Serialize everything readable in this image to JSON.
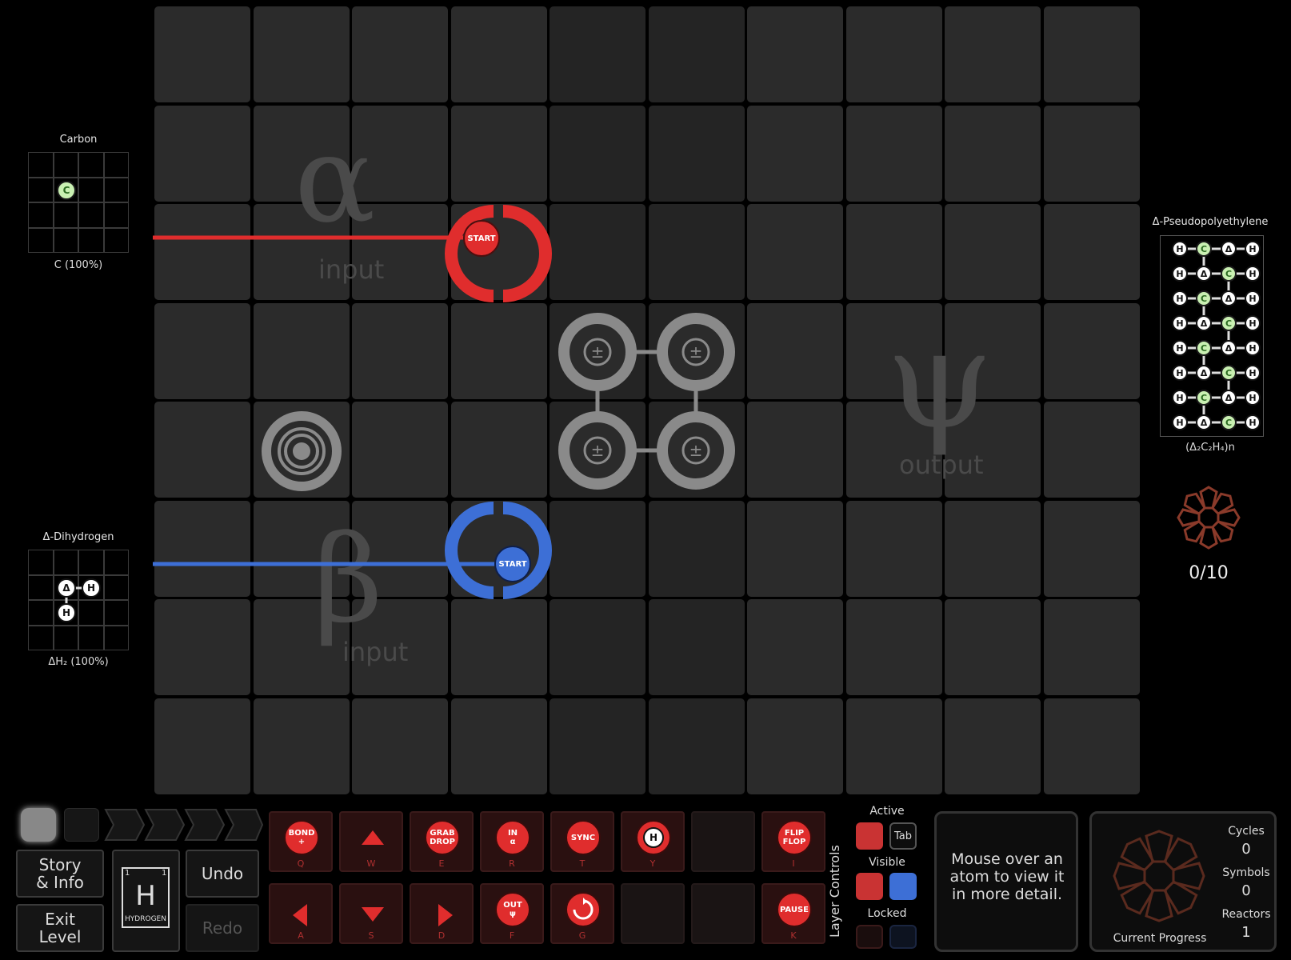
{
  "grid": {
    "cols": 10,
    "rows": 8
  },
  "zones": {
    "alpha": {
      "letter": "α",
      "word": "input"
    },
    "beta": {
      "letter": "β",
      "word": "input"
    },
    "psi": {
      "letter": "ψ",
      "word": "output"
    }
  },
  "waldos": {
    "red_start": "START",
    "blue_start": "START"
  },
  "inputs": [
    {
      "name": "Carbon",
      "formula": "C (100%)"
    },
    {
      "name": "Δ-Dihydrogen",
      "formula": "ΔH₂ (100%)"
    }
  ],
  "output": {
    "name": "Δ-Pseudopolyethylene",
    "formula": "(Δ₂C₂H₄)n",
    "progress": "0/10"
  },
  "atoms": {
    "carbon": "C",
    "hydrogen": "H",
    "delta": "Δ"
  },
  "output_rows": [
    [
      "H",
      "C",
      "Δ",
      "H"
    ],
    [
      "H",
      "Δ",
      "C",
      "H"
    ],
    [
      "H",
      "C",
      "Δ",
      "H"
    ],
    [
      "H",
      "Δ",
      "C",
      "H"
    ],
    [
      "H",
      "C",
      "Δ",
      "H"
    ],
    [
      "H",
      "Δ",
      "C",
      "H"
    ],
    [
      "H",
      "C",
      "Δ",
      "H"
    ],
    [
      "H",
      "Δ",
      "C",
      "H"
    ]
  ],
  "toolbar": {
    "story": "Story\n& Info",
    "exit": "Exit\nLevel",
    "undo": "Undo",
    "redo": "Redo",
    "element": {
      "symbol": "H",
      "name": "HYDROGEN",
      "num_left": "1",
      "num_right": "1"
    }
  },
  "instructions": {
    "bond": {
      "label": "BOND\n+",
      "key": "Q"
    },
    "up": {
      "key": "W"
    },
    "grab": {
      "label": "GRAB\nDROP",
      "key": "E"
    },
    "in": {
      "label": "IN\nα",
      "key": "R"
    },
    "sync": {
      "label": "SYNC",
      "key": "T"
    },
    "sense": {
      "label": "H",
      "key": "Y"
    },
    "flip": {
      "label": "FLIP\nFLOP",
      "key": "I"
    },
    "left": {
      "key": "A"
    },
    "down": {
      "key": "S"
    },
    "right": {
      "key": "D"
    },
    "out": {
      "label": "OUT\nψ",
      "key": "F"
    },
    "rotate": {
      "key": "G"
    },
    "pause": {
      "label": "PAUSE",
      "key": "K"
    }
  },
  "layer_controls": {
    "title": "Layer Controls",
    "active": "Active",
    "visible": "Visible",
    "locked": "Locked",
    "tab": "Tab"
  },
  "info_panel": {
    "text": "Mouse over an atom to view it in more detail."
  },
  "stats": {
    "cycles_label": "Cycles",
    "cycles": "0",
    "symbols_label": "Symbols",
    "symbols": "0",
    "reactors_label": "Reactors",
    "reactors": "1",
    "progress_label": "Current Progress"
  },
  "colors": {
    "red": "#e02d2d",
    "blue": "#3d6fd6",
    "carbon": "#c9f0b2"
  }
}
